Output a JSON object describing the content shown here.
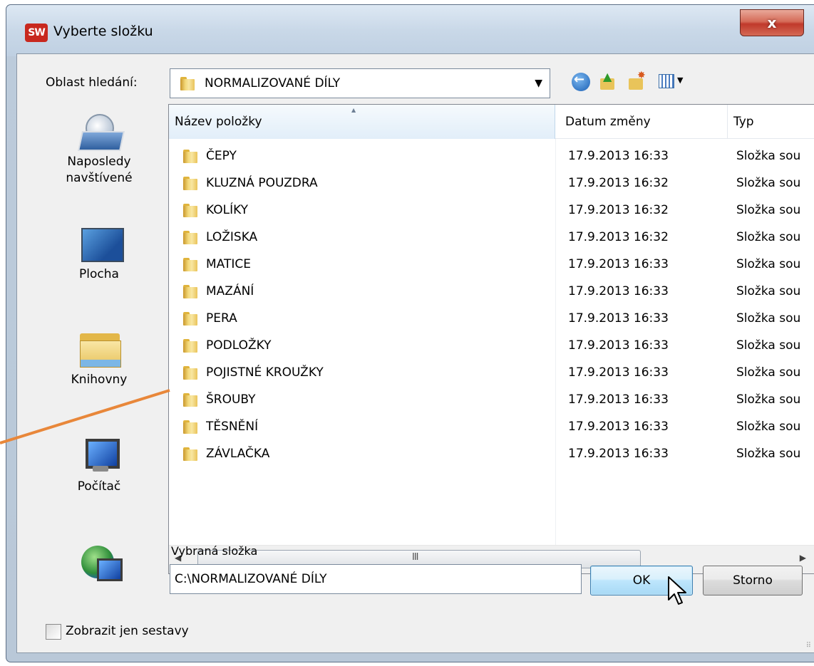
{
  "window": {
    "app_icon_text": "SW",
    "title": "Vyberte složku",
    "close_label": "x"
  },
  "toolbar": {
    "look_in_label": "Oblast hledání:",
    "current_folder": "NORMALIZOVANÉ DÍLY",
    "icons": [
      "back-icon",
      "up-folder-icon",
      "new-folder-icon",
      "view-menu-icon"
    ]
  },
  "places": [
    {
      "label": "Naposledy navštívené",
      "icon": "recent-places-icon"
    },
    {
      "label": "Plocha",
      "icon": "desktop-icon"
    },
    {
      "label": "Knihovny",
      "icon": "libraries-icon"
    },
    {
      "label": "Počítač",
      "icon": "computer-icon"
    },
    {
      "label": "",
      "icon": "network-icon"
    }
  ],
  "columns": {
    "name": "Název položky",
    "date": "Datum změny",
    "type": "Typ"
  },
  "files": [
    {
      "name": "ČEPY",
      "date": "17.9.2013 16:33",
      "type": "Složka sou"
    },
    {
      "name": "KLUZNÁ POUZDRA",
      "date": "17.9.2013 16:32",
      "type": "Složka sou"
    },
    {
      "name": "KOLÍKY",
      "date": "17.9.2013 16:32",
      "type": "Složka sou"
    },
    {
      "name": "LOŽISKA",
      "date": "17.9.2013 16:32",
      "type": "Složka sou"
    },
    {
      "name": "MATICE",
      "date": "17.9.2013 16:33",
      "type": "Složka sou"
    },
    {
      "name": "MAZÁNÍ",
      "date": "17.9.2013 16:33",
      "type": "Složka sou"
    },
    {
      "name": "PERA",
      "date": "17.9.2013 16:33",
      "type": "Složka sou"
    },
    {
      "name": "PODLOŽKY",
      "date": "17.9.2013 16:33",
      "type": "Složka sou"
    },
    {
      "name": "POJISTNÉ KROUŽKY",
      "date": "17.9.2013 16:33",
      "type": "Složka sou"
    },
    {
      "name": "ŠROUBY",
      "date": "17.9.2013 16:33",
      "type": "Složka sou"
    },
    {
      "name": "TĚSNĚNÍ",
      "date": "17.9.2013 16:33",
      "type": "Složka sou"
    },
    {
      "name": "ZÁVLAČKA",
      "date": "17.9.2013 16:33",
      "type": "Složka sou"
    }
  ],
  "scrollbar": {
    "grip": "III"
  },
  "selection": {
    "label": "Vybraná složka",
    "value": "C:\\NORMALIZOVANÉ DÍLY"
  },
  "buttons": {
    "ok": "OK",
    "cancel": "Storno"
  },
  "checkbox": {
    "label": "Zobrazit jen sestavy",
    "checked": false
  },
  "colors": {
    "annotation_line": "#e8873a",
    "title_close": "#c0392b",
    "ok_button_border": "#3c7fb1"
  }
}
